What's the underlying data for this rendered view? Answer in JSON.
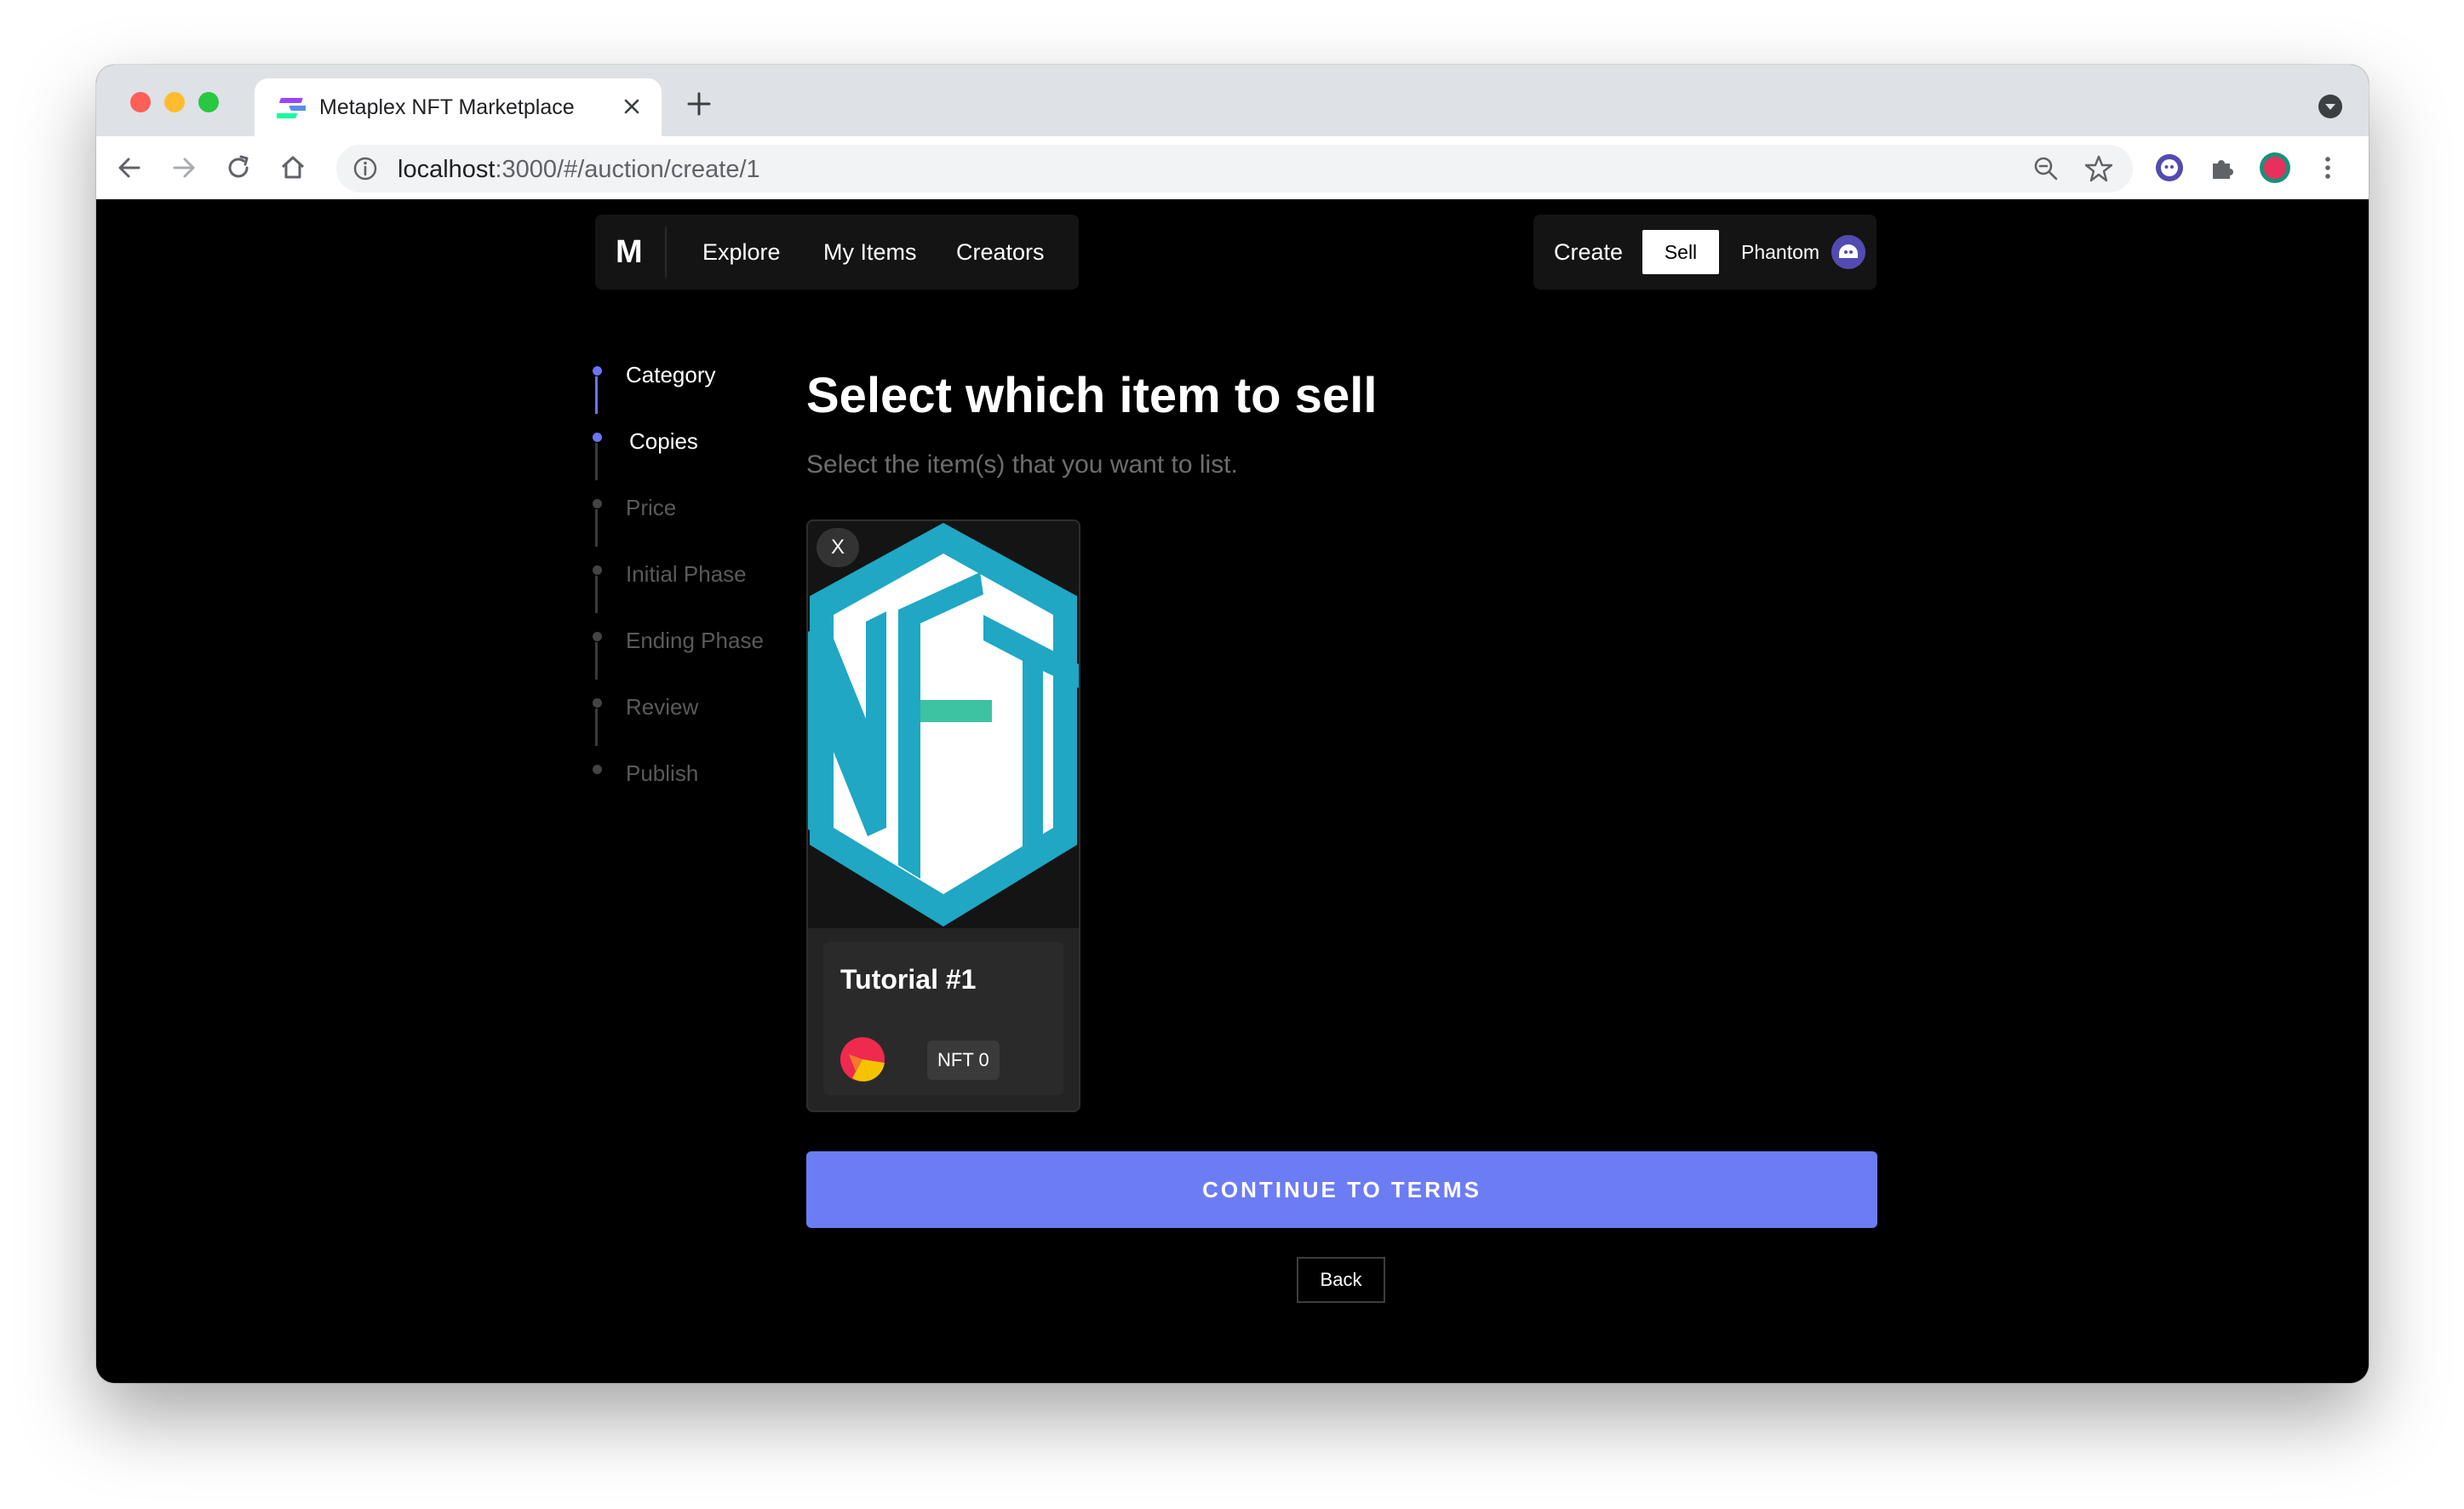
{
  "browser": {
    "tab_title": "Metaplex NFT Marketplace",
    "url_host": "localhost",
    "url_rest": ":3000/#/auction/create/1"
  },
  "nav": {
    "logo": "M",
    "links": [
      "Explore",
      "My Items",
      "Creators"
    ],
    "create_label": "Create",
    "sell_label": "Sell",
    "wallet_label": "Phantom"
  },
  "steps": [
    {
      "label": "Category",
      "state": "done"
    },
    {
      "label": "Copies",
      "state": "current"
    },
    {
      "label": "Price",
      "state": "pending"
    },
    {
      "label": "Initial Phase",
      "state": "pending"
    },
    {
      "label": "Ending Phase",
      "state": "pending"
    },
    {
      "label": "Review",
      "state": "pending"
    },
    {
      "label": "Publish",
      "state": "pending"
    }
  ],
  "main": {
    "heading": "Select which item to sell",
    "subheading": "Select the item(s) that you want to list.",
    "card": {
      "remove_label": "X",
      "title": "Tutorial #1",
      "edition": "NFT 0"
    },
    "continue_label": "CONTINUE TO TERMS",
    "back_label": "Back"
  },
  "colors": {
    "accent": "#6c7cf5",
    "nft_teal": "#1fa7c4",
    "nft_green": "#3dc3a2"
  }
}
